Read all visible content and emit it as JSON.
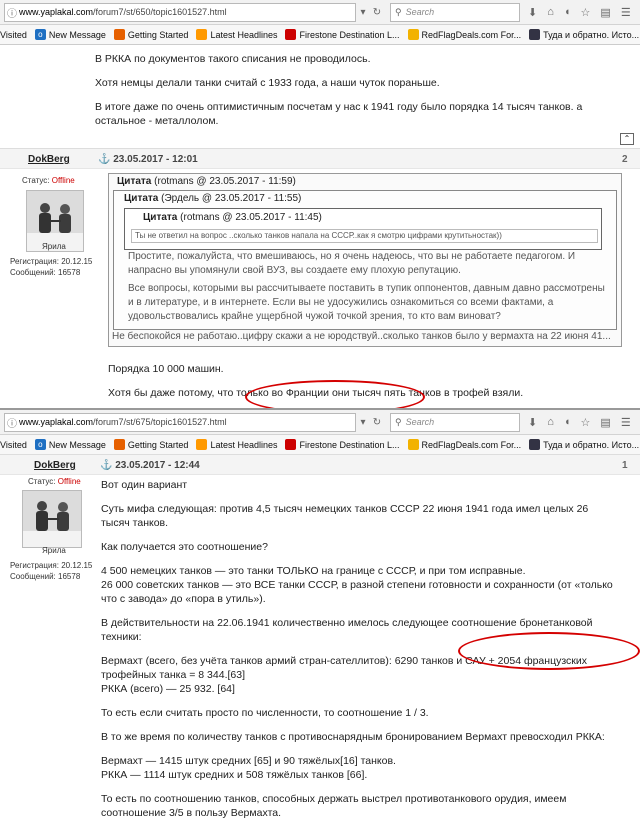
{
  "shot1": {
    "url_domain": "www.yaplakal.com",
    "url_path": "/forum7/st/650/topic1601527.html",
    "search_placeholder": "Search",
    "bookmarks": [
      "Visited",
      "New Message",
      "Getting Started",
      "Latest Headlines",
      "Firestone Destination L...",
      "RedFlagDeals.com For...",
      "Туда и обратно. Исто..."
    ],
    "prev_post": {
      "paragraphs": [
        "В РККА по документов такого списания не проводилось.",
        "Хотя немцы делали танки считай с 1933 года, а наши чуток пораньше.",
        "В итоге даже по очень оптимистичным посчетам у нас к 1941 году было порядка 14 тысяч танков. а остальное - металлолом."
      ]
    },
    "post": {
      "username": "DokBerg",
      "date": "23.05.2017 - 12:01",
      "number": "2",
      "status_label": "Статус:",
      "status_value": "Offline",
      "avatar_caption": "Ярила",
      "reg_label": "Регистрация:",
      "reg_value": "20.12.15",
      "msgs_label": "Сообщений:",
      "msgs_value": "16578",
      "quote1_title": "Цитата",
      "quote1_meta": "(rotmans @ 23.05.2017 - 11:59)",
      "quote2_title": "Цитата",
      "quote2_meta": "(Эрдель @ 23.05.2017 - 11:55)",
      "quote3_title": "Цитата",
      "quote3_meta": "(rotmans @ 23.05.2017 - 11:45)",
      "quote3_text": "Ты не ответил на вопрос ..сколько танков напала на СССР..как я смотрю цифрами крутитьностак))",
      "quote2_p1": "Простите, пожалуйста, что вмешиваюсь, но я очень надеюсь, что вы не работаете педагогом. И напрасно вы упомянули свой ВУЗ, вы создаете ему плохую репутацию.",
      "quote2_p2": "Все вопросы, которыми вы рассчитываете поставить в тупик оппонентов, давным давно рассмотрены и в литературе, и в интернете. Если вы не удосужились ознакомиться со всеми фактами, а удовольствовались крайне ущербной чужой точкой зрения, то кто вам виноват?",
      "quote1_text": "Не беспокойся не работаю..цифру скажи а не юродствуй..сколько танков было у вермахта на 22 июня 41...",
      "body_p1": "Порядка 10 000 машин.",
      "body_p2": "Хотя бы даже потому, что только во Франции они тысяч пять танков в трофей взяли."
    }
  },
  "shot2": {
    "url_domain": "www.yaplakal.com",
    "url_path": "/forum7/st/675/topic1601527.html",
    "search_placeholder": "Search",
    "bookmarks": [
      "Visited",
      "New Message",
      "Getting Started",
      "Latest Headlines",
      "Firestone Destination L...",
      "RedFlagDeals.com For...",
      "Туда и обратно. Исто..."
    ],
    "post": {
      "username": "DokBerg",
      "date": "23.05.2017 - 12:44",
      "number": "1",
      "status_label": "Статус:",
      "status_value": "Offline",
      "avatar_caption": "Ярила",
      "reg_label": "Регистрация:",
      "reg_value": "20.12.15",
      "msgs_label": "Сообщений:",
      "msgs_value": "16578",
      "p1": "Вот один вариант",
      "p2": "Суть мифа следующая: против 4,5 тысяч немецких танков СССР 22 июня 1941 года имел целых 26 тысяч танков.",
      "p3": "Как получается это соотношение?",
      "p4a": "4 500 немецких танков — это танки ТОЛЬКО на границе с СССР, и при том исправные.",
      "p4b": "26 000 советских танков — это ВСЕ танки СССР, в разной степени готовности и сохранности (от «только что с завода» до «пора в утиль»).",
      "p5": "В действительности на 22.06.1941 количественно имелось следующее соотношение бронетанковой техники:",
      "p6a": "Вермахт (всего, без учёта танков армий стран-сателлитов): 6290 танков и САУ + 2054 французских трофейных танка = 8 344.[63]",
      "p6b": "РККА (всего) — 25 932. [64]",
      "p7": "То есть если считать просто по численности, то соотношение 1 / 3.",
      "p8": "В то же время по количеству танков с противоснарядным бронированием Вермахт превосходил РККА:",
      "p9a": "Вермахт — 1415 штук средних [65] и 90 тяжёлых[16] танков.",
      "p9b": "РККА — 1114 штук средних и 508 тяжёлых танков [66].",
      "p10": "То есть по соотношению танков, способных держать выстрел противотанкового орудия, имеем соотношение 3/5 в пользу Вермахта."
    }
  },
  "colors": {
    "offline": "#cc0000",
    "annotation": "#d40000"
  }
}
